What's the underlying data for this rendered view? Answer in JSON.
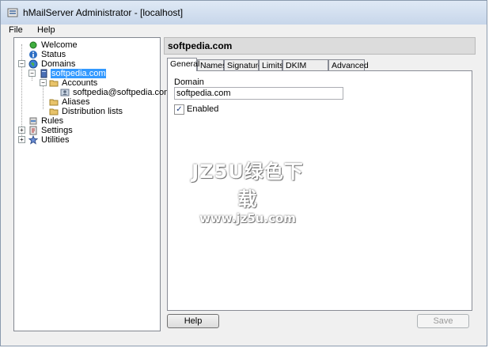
{
  "window": {
    "title": "hMailServer Administrator - [localhost]"
  },
  "menu": {
    "items": [
      "File",
      "Help"
    ]
  },
  "tree": {
    "welcome": "Welcome",
    "status": "Status",
    "domains": "Domains",
    "domain": "softpedia.com",
    "accounts": "Accounts",
    "account": "softpedia@softpedia.com",
    "aliases": "Aliases",
    "distribution_lists": "Distribution lists",
    "rules": "Rules",
    "settings": "Settings",
    "utilities": "Utilities"
  },
  "content": {
    "header": "softpedia.com",
    "tabs": [
      "General",
      "Names",
      "Signature",
      "Limits",
      "DKIM Signing",
      "Advanced"
    ],
    "active_tab": "General",
    "domain_label": "Domain",
    "domain_value": "softpedia.com",
    "enabled_label": "Enabled",
    "enabled_checked": true
  },
  "buttons": {
    "help": "Help",
    "save": "Save"
  },
  "watermark": {
    "line1": "JZ5U绿色下载",
    "line2": "www.jz5u.com"
  },
  "colors": {
    "selection": "#3399ff",
    "titlebar": "#c7d6ea"
  }
}
